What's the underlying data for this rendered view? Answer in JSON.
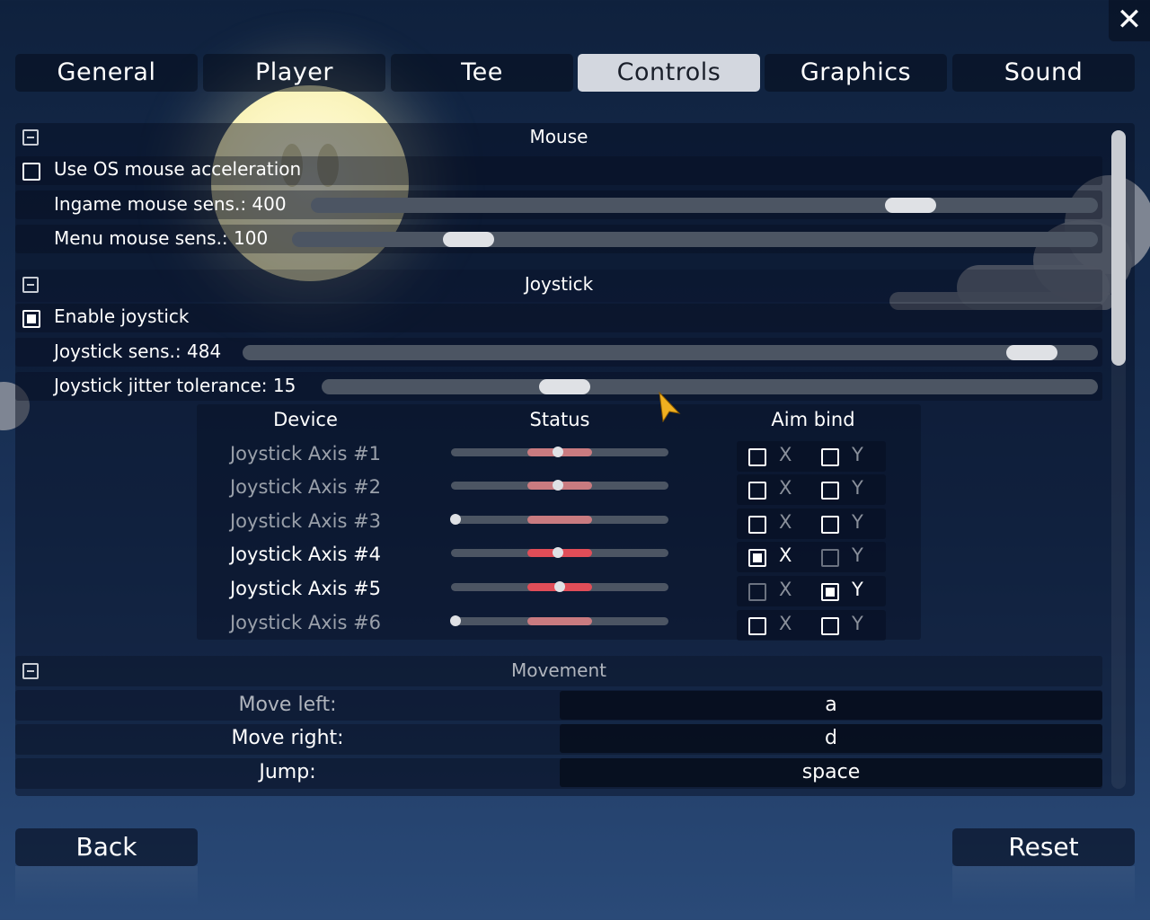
{
  "tabs": [
    {
      "label": "General",
      "active": false
    },
    {
      "label": "Player",
      "active": false
    },
    {
      "label": "Tee",
      "active": false
    },
    {
      "label": "Controls",
      "active": true
    },
    {
      "label": "Graphics",
      "active": false
    },
    {
      "label": "Sound",
      "active": false
    }
  ],
  "close_label": "✕",
  "mouse": {
    "title": "Mouse",
    "os_accel_label": "Use OS mouse acceleration",
    "os_accel_checked": false,
    "ingame_sens_label": "Ingame mouse sens.: 400",
    "ingame_sens_fraction": 0.78,
    "menu_sens_label": "Menu mouse sens.: 100",
    "menu_sens_fraction": 0.2
  },
  "joystick": {
    "title": "Joystick",
    "enable_label": "Enable joystick",
    "enable_checked": true,
    "sens_label": "Joystick sens.: 484",
    "sens_fraction": 0.95,
    "jitter_label": "Joystick jitter tolerance: 15",
    "jitter_fraction": 0.3,
    "headers": {
      "device": "Device",
      "status": "Status",
      "aim_bind": "Aim bind"
    },
    "axes": [
      {
        "name": "Joystick Axis #1",
        "status": 0.49,
        "active": false,
        "x_checked": false,
        "y_checked": false,
        "x_dim": false,
        "y_dim": false
      },
      {
        "name": "Joystick Axis #2",
        "status": 0.49,
        "active": false,
        "x_checked": false,
        "y_checked": false,
        "x_dim": false,
        "y_dim": false
      },
      {
        "name": "Joystick Axis #3",
        "status": 0.02,
        "active": false,
        "x_checked": false,
        "y_checked": false,
        "x_dim": false,
        "y_dim": false
      },
      {
        "name": "Joystick Axis #4",
        "status": 0.49,
        "active": true,
        "x_checked": true,
        "y_checked": false,
        "x_dim": false,
        "y_dim": true
      },
      {
        "name": "Joystick Axis #5",
        "status": 0.5,
        "active": true,
        "x_checked": false,
        "y_checked": true,
        "x_dim": true,
        "y_dim": false
      },
      {
        "name": "Joystick Axis #6",
        "status": 0.02,
        "active": false,
        "x_checked": false,
        "y_checked": false,
        "x_dim": false,
        "y_dim": false
      }
    ],
    "x_label": "X",
    "y_label": "Y"
  },
  "movement": {
    "title": "Movement",
    "binds": [
      {
        "label": "Move left:",
        "key": "a",
        "dim": true
      },
      {
        "label": "Move right:",
        "key": "d",
        "dim": false
      },
      {
        "label": "Jump:",
        "key": "space",
        "dim": false
      }
    ]
  },
  "back_label": "Back",
  "reset_label": "Reset"
}
